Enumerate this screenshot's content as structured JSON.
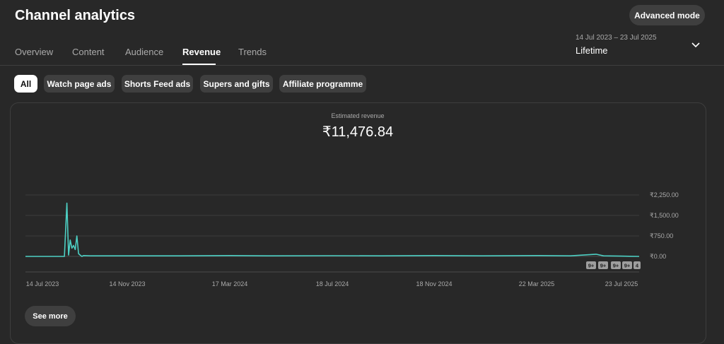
{
  "header": {
    "title": "Channel analytics",
    "advanced_mode": "Advanced mode"
  },
  "tabs": [
    {
      "label": "Overview"
    },
    {
      "label": "Content"
    },
    {
      "label": "Audience"
    },
    {
      "label": "Revenue",
      "active": true
    },
    {
      "label": "Trends"
    }
  ],
  "date_picker": {
    "range": "14 Jul 2023 – 23 Jul 2025",
    "period": "Lifetime",
    "icon": "chevron-down-icon"
  },
  "filters": [
    {
      "label": "All",
      "active": true
    },
    {
      "label": "Watch page ads"
    },
    {
      "label": "Shorts Feed ads"
    },
    {
      "label": "Supers and gifts"
    },
    {
      "label": "Affiliate programme"
    }
  ],
  "metric": {
    "label": "Estimated revenue",
    "value": "₹11,476.84"
  },
  "chart_data": {
    "type": "line",
    "title": "",
    "xlabel": "",
    "ylabel": "",
    "x_ticks": [
      "14 Jul 2023",
      "14 Nov 2023",
      "17 Mar 2024",
      "18 Jul 2024",
      "18 Nov 2024",
      "22 Mar 2025",
      "23 Jul 2025"
    ],
    "y_ticks": [
      "₹0.00",
      "₹750.00",
      "₹1,500.00",
      "₹2,250.00"
    ],
    "ylim": [
      0,
      2250
    ],
    "y_axis_side": "right",
    "grid": true,
    "series": [
      {
        "color": "#3ea6ff",
        "line_color": "#4dd0c4",
        "x": [
          "2023-07-14",
          "2023-08-20",
          "2023-08-30",
          "2023-09-02",
          "2023-09-04",
          "2023-09-06",
          "2023-09-08",
          "2023-09-10",
          "2023-09-12",
          "2023-09-14",
          "2023-09-16",
          "2023-09-18",
          "2023-09-20",
          "2023-09-22",
          "2023-10-01",
          "2023-11-14",
          "2024-01-15",
          "2024-03-17",
          "2024-05-01",
          "2024-07-18",
          "2024-09-15",
          "2024-11-18",
          "2025-01-15",
          "2025-03-22",
          "2025-05-01",
          "2025-06-01",
          "2025-06-10",
          "2025-07-01",
          "2025-07-23"
        ],
        "values": [
          0,
          0,
          0,
          1950,
          50,
          600,
          300,
          400,
          250,
          750,
          100,
          50,
          0,
          30,
          20,
          20,
          20,
          30,
          20,
          25,
          20,
          30,
          20,
          30,
          20,
          80,
          20,
          10,
          0
        ]
      }
    ],
    "annotations": [
      "9+",
      "9+",
      "9+",
      "9+",
      "4"
    ]
  },
  "footer": {
    "see_more": "See more"
  }
}
